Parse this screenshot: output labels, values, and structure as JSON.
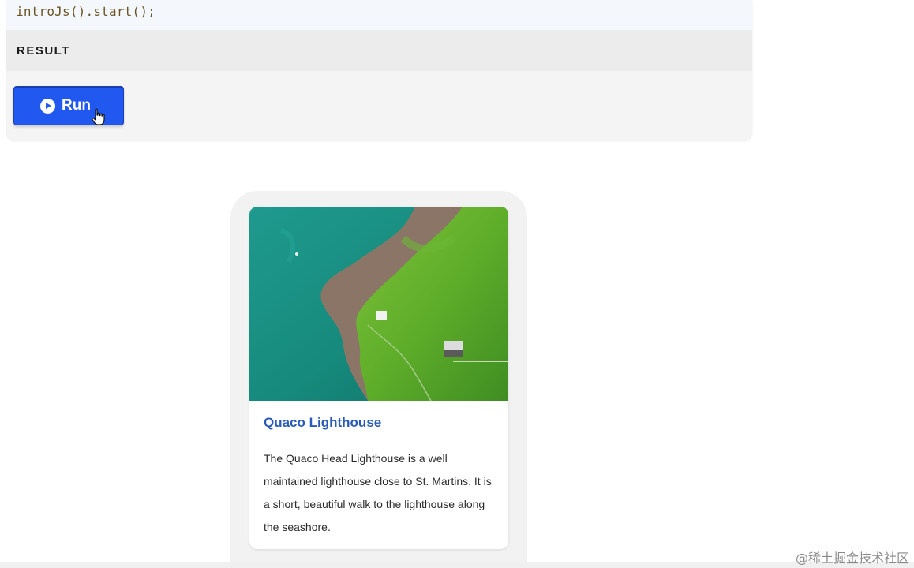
{
  "code": {
    "line": "introJs().start();"
  },
  "result": {
    "label": "RESULT"
  },
  "run_button": {
    "label": "Run",
    "icon": "play-circle-icon",
    "color": "#2159f0"
  },
  "card": {
    "image_alt": "Aerial view of a green coastal headland with a lighthouse",
    "title": "Quaco Lighthouse",
    "description": "The Quaco Head Lighthouse is a well maintained lighthouse close to St. Martins. It is a short, beautiful walk to the lighthouse along the seashore.",
    "title_color": "#2a5bb8"
  },
  "watermark": {
    "text": "@稀土掘金技术社区"
  }
}
